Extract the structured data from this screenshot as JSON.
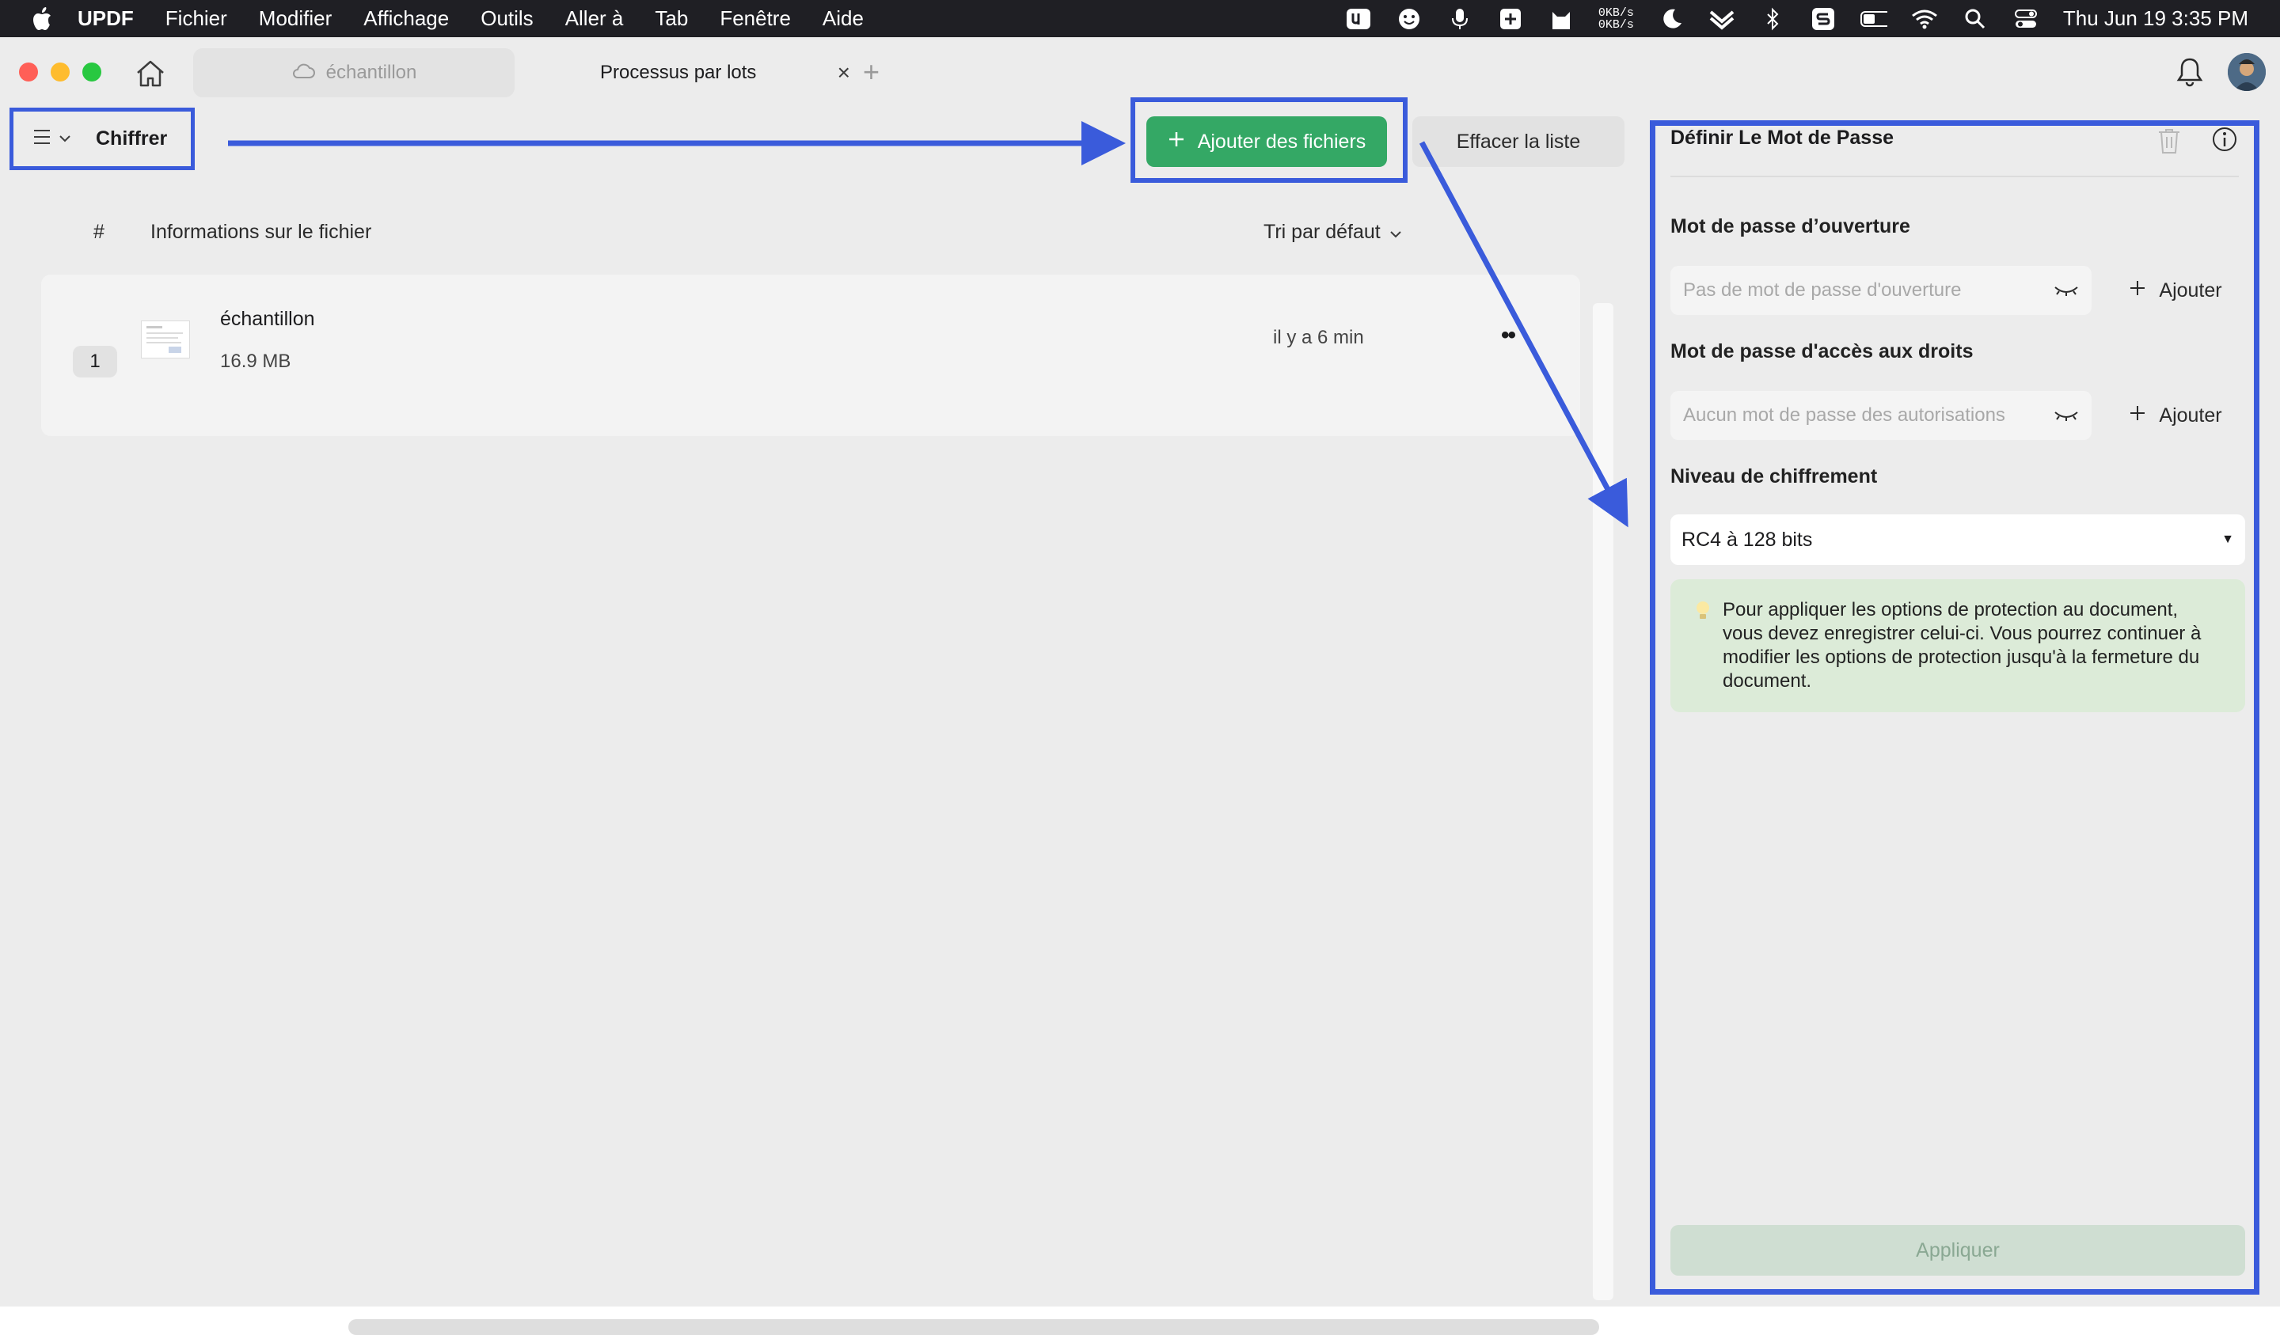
{
  "menubar": {
    "items": [
      "UPDF",
      "Fichier",
      "Modifier",
      "Affichage",
      "Outils",
      "Aller à",
      "Tab",
      "Fenêtre",
      "Aide"
    ],
    "net_up": "0KB/s",
    "net_down": "0KB/s",
    "clock": "Thu Jun 19  3:35 PM"
  },
  "tabs": {
    "inactive_label": "échantillon",
    "active_label": "Processus par lots",
    "close_glyph": "×",
    "new_glyph": "+"
  },
  "toolbar": {
    "mode_label": "Chiffrer",
    "add_files_label": "Ajouter des fichiers",
    "clear_list_label": "Effacer la liste"
  },
  "list": {
    "col_hash": "#",
    "col_info": "Informations sur le fichier",
    "sort_label": "Tri par défaut",
    "files": [
      {
        "index": "1",
        "name": "échantillon",
        "size": "16.9 MB",
        "time": "il y a 6 min",
        "more": "••"
      }
    ]
  },
  "panel": {
    "title": "Définir Le Mot de Passe",
    "open_pw_label": "Mot de passe d’ouverture",
    "open_pw_placeholder": "Pas de mot de passe d'ouverture",
    "perm_pw_label": "Mot de passe d'accès aux droits",
    "perm_pw_placeholder": "Aucun mot de passe des autorisations",
    "add_label": "Ajouter",
    "encryption_label": "Niveau de chiffrement",
    "encryption_value": "RC4 à 128 bits",
    "tip_text": "Pour appliquer les options de protection au document, vous devez enregistrer celui-ci. Vous pourrez continuer à modifier les options de protection jusqu'à la fermeture du document.",
    "apply_label": "Appliquer"
  },
  "colors": {
    "annotation_blue": "#3a5bdb",
    "primary_green": "#34a865",
    "tip_green": "#dcebd8"
  }
}
